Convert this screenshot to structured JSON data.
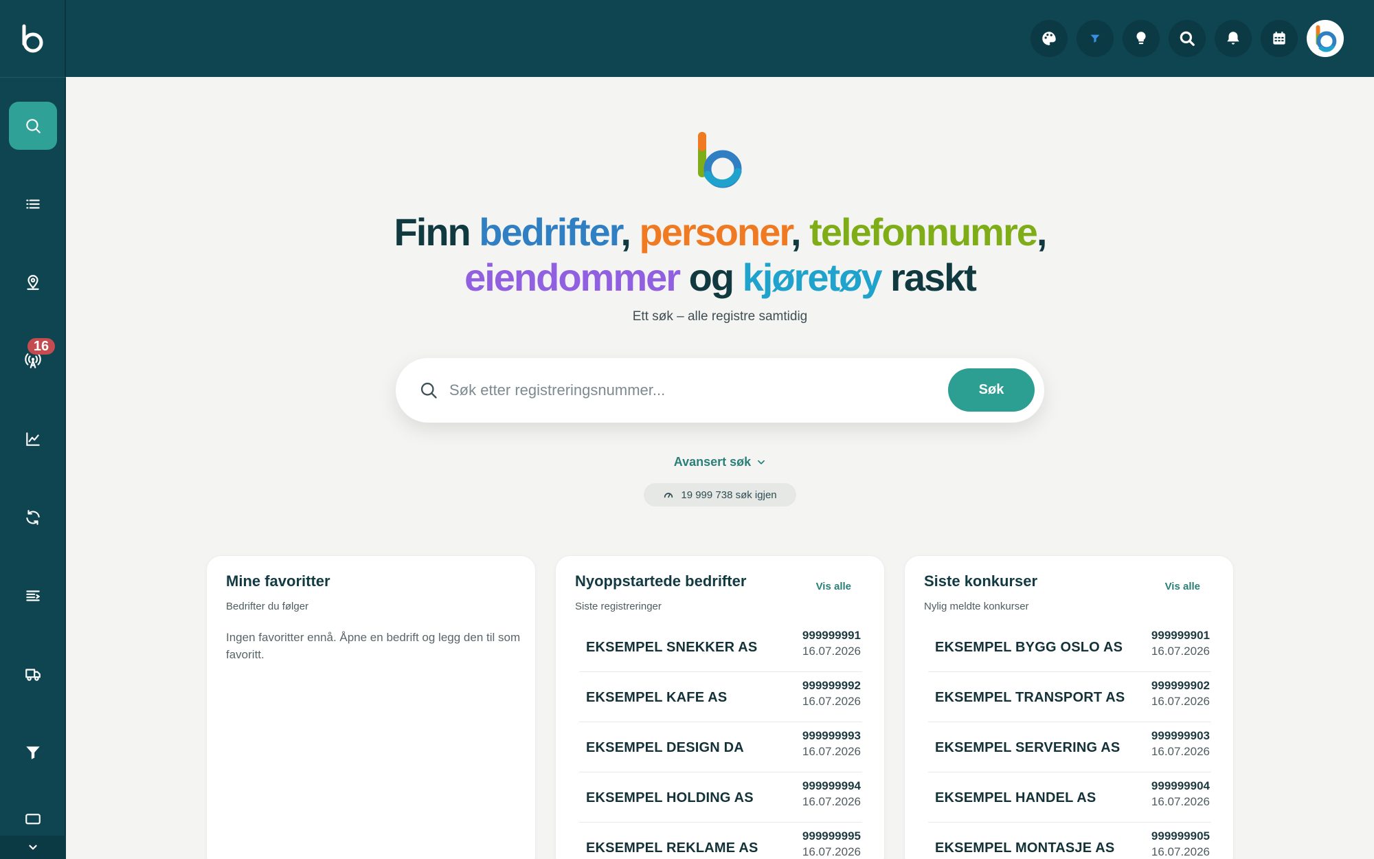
{
  "sidebar": {
    "items": [
      {
        "icon": "search-icon",
        "active": true
      },
      {
        "icon": "list-icon"
      },
      {
        "icon": "map-pin-icon"
      },
      {
        "icon": "broadcast-tower-icon",
        "badge": "16"
      },
      {
        "icon": "chart-line-icon"
      },
      {
        "icon": "refresh-icon"
      },
      {
        "icon": "text-list-icon"
      },
      {
        "icon": "truck-icon"
      },
      {
        "icon": "filter-icon"
      },
      {
        "icon": "monitor-icon"
      }
    ],
    "badge_count": "16"
  },
  "topbar": {
    "icons": [
      "palette-icon",
      "filter-icon",
      "lightbulb-icon",
      "search-icon",
      "bell-icon",
      "calendar-icon"
    ],
    "accent": "#0f4550"
  },
  "hero": {
    "headline": {
      "w1": "Finn",
      "w2": "bedrifter",
      "sep1": ",",
      "w3": "personer",
      "sep2": ",",
      "w4": "telefonnumre",
      "sep3": ",",
      "w5": "eiendommer",
      "w6": "og",
      "w7": "kjøretøy",
      "w8": "raskt"
    },
    "subtitle": "Ett søk – alle registre samtidig"
  },
  "search": {
    "placeholder": "Søk etter registreringsnummer...",
    "value": "",
    "button_label": "Søk"
  },
  "advanced": {
    "label": "Avansert søk"
  },
  "counter": {
    "text": "19 999 738 søk igjen"
  },
  "cards": {
    "favorites": {
      "title": "Mine favoritter",
      "subtitle": "Bedrifter du følger",
      "empty_text": "Ingen favoritter ennå. Åpne en bedrift og legg den til som favoritt."
    },
    "new_companies": {
      "title": "Nyoppstartede bedrifter",
      "subtitle": "Siste registreringer",
      "link": "Vis alle",
      "rows": [
        {
          "name": "EKSEMPEL SNEKKER AS",
          "number": "999999991",
          "date": "16.07.2026"
        },
        {
          "name": "EKSEMPEL KAFE AS",
          "number": "999999992",
          "date": "16.07.2026"
        },
        {
          "name": "EKSEMPEL DESIGN DA",
          "number": "999999993",
          "date": "16.07.2026"
        },
        {
          "name": "EKSEMPEL HOLDING AS",
          "number": "999999994",
          "date": "16.07.2026"
        },
        {
          "name": "EKSEMPEL REKLAME AS",
          "number": "999999995",
          "date": "16.07.2026"
        }
      ]
    },
    "bankruptcies": {
      "title": "Siste konkurser",
      "subtitle": "Nylig meldte konkurser",
      "link": "Vis alle",
      "rows": [
        {
          "name": "EKSEMPEL BYGG OSLO AS",
          "number": "999999901",
          "date": "16.07.2026"
        },
        {
          "name": "EKSEMPEL TRANSPORT AS",
          "number": "999999902",
          "date": "16.07.2026"
        },
        {
          "name": "EKSEMPEL SERVERING AS",
          "number": "999999903",
          "date": "16.07.2026"
        },
        {
          "name": "EKSEMPEL HANDEL AS",
          "number": "999999904",
          "date": "16.07.2026"
        },
        {
          "name": "EKSEMPEL MONTASJE AS",
          "number": "999999905",
          "date": "16.07.2026"
        }
      ]
    }
  },
  "colors": {
    "sidebar_bg": "#0f4550",
    "primary": "#2d9e92",
    "blue": "#2f7fc2",
    "orange": "#ef7a22",
    "green": "#7fad18",
    "purple": "#9160e0",
    "cyan": "#1fa2cc",
    "badge": "#c44b4f"
  }
}
